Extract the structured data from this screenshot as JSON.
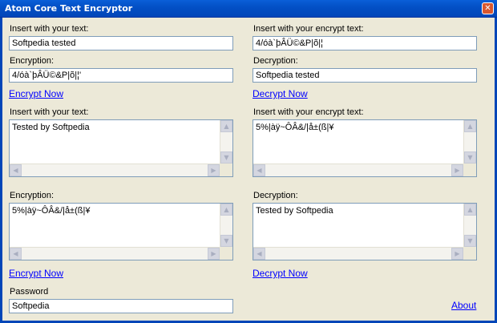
{
  "window": {
    "title": "Atom Core Text Encryptor",
    "close_glyph": "✕"
  },
  "left": {
    "insert1": {
      "label": "Insert with your text:",
      "value": "Softpedia tested"
    },
    "enc1": {
      "label": "Encryption:",
      "value": "4/óà`þÂÜ©&P|õ|¦'"
    },
    "encrypt1_link": "Encrypt Now",
    "insert2": {
      "label": "Insert with your text:",
      "value": "Tested by Softpedia"
    },
    "enc2": {
      "label": "Encryption:",
      "value": "5%|àÿ~ÔÂ&/|å±(ß|¥"
    },
    "encrypt2_link": "Encrypt Now",
    "password": {
      "label": "Password",
      "value": "Softpedia"
    }
  },
  "right": {
    "insert1": {
      "label": "Insert with your encrypt text:",
      "value": "4/óà`þÂÜ©&P|õ|¦"
    },
    "dec1": {
      "label": "Decryption:",
      "value": "Softpedia tested"
    },
    "decrypt1_link": "Decrypt Now",
    "insert2": {
      "label": "Insert with your encrypt text:",
      "value": "5%|àÿ~ÔÂ&/|å±(ß|¥"
    },
    "dec2": {
      "label": "Decryption:",
      "value": "Tested by Softpedia"
    },
    "decrypt2_link": "Decrypt Now",
    "about_link": "About"
  },
  "scroll_glyphs": {
    "up": "▲",
    "down": "▼",
    "left": "◀",
    "right": "▶"
  }
}
